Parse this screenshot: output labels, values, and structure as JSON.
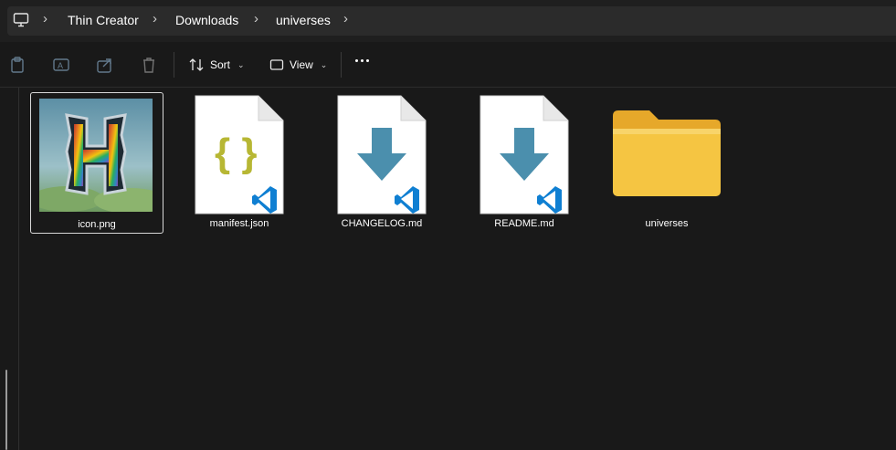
{
  "breadcrumb": {
    "items": [
      "Thin Creator",
      "Downloads",
      "universes"
    ]
  },
  "toolbar": {
    "sort_label": "Sort",
    "view_label": "View"
  },
  "files": [
    {
      "name": "icon.png",
      "type": "image",
      "selected": true
    },
    {
      "name": "manifest.json",
      "type": "json"
    },
    {
      "name": "CHANGELOG.md",
      "type": "markdown"
    },
    {
      "name": "README.md",
      "type": "markdown"
    },
    {
      "name": "universes",
      "type": "folder"
    }
  ],
  "colors": {
    "background": "#191919",
    "vscode_blue": "#0f7fd2",
    "md_arrow": "#4b8fad",
    "json_braces": "#b7b734",
    "folder": "#f5c542"
  }
}
